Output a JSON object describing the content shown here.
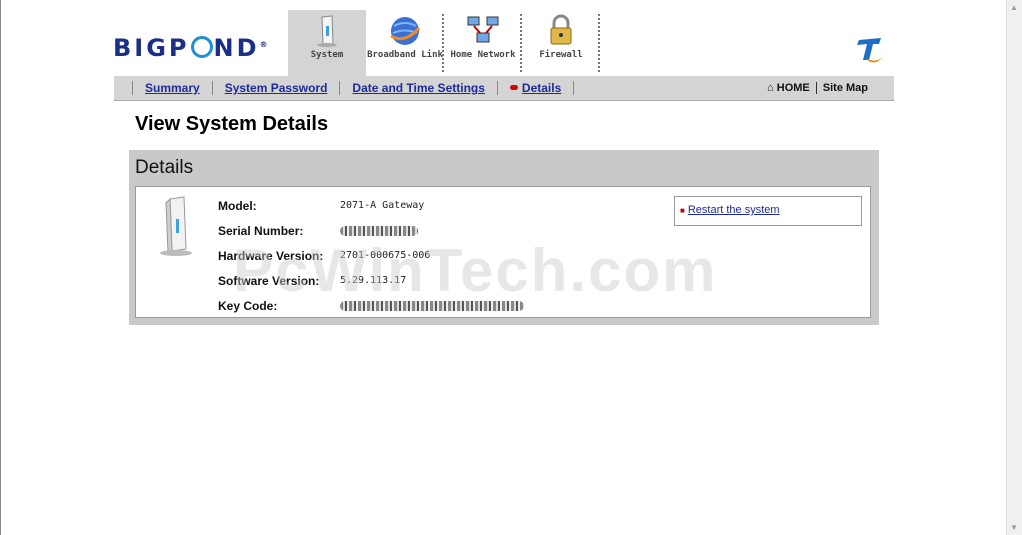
{
  "brand": {
    "logo_text_a": "BIGP",
    "logo_text_b": "ND",
    "logo_mark": "®"
  },
  "tabs": [
    {
      "label": "System",
      "icon": "system-device-icon",
      "active": true
    },
    {
      "label": "Broadband Link",
      "icon": "globe-icon",
      "active": false
    },
    {
      "label": "Home Network",
      "icon": "network-computers-icon",
      "active": false
    },
    {
      "label": "Firewall",
      "icon": "padlock-icon",
      "active": false
    }
  ],
  "subnav": {
    "links": [
      "Summary",
      "System Password",
      "Date and Time Settings",
      "Details"
    ],
    "home_label": "HOME",
    "sitemap_label": "Site Map"
  },
  "page": {
    "title": "View System Details"
  },
  "details": {
    "panel_title": "Details",
    "fields": [
      {
        "label": "Model:",
        "value": "2071-A Gateway"
      },
      {
        "label": "Serial Number:",
        "value": ""
      },
      {
        "label": "Hardware Version:",
        "value": "2701-000675-006"
      },
      {
        "label": "Software Version:",
        "value": "5.29.113.17"
      },
      {
        "label": "Key Code:",
        "value": ""
      }
    ],
    "action_label": "Restart the system"
  },
  "watermark": "PcWinTech.com",
  "colors": {
    "link": "#1d2a9c",
    "nav_bg": "#d4d4d4",
    "brand_blue": "#1b2f86",
    "accent_red": "#dd0000"
  }
}
